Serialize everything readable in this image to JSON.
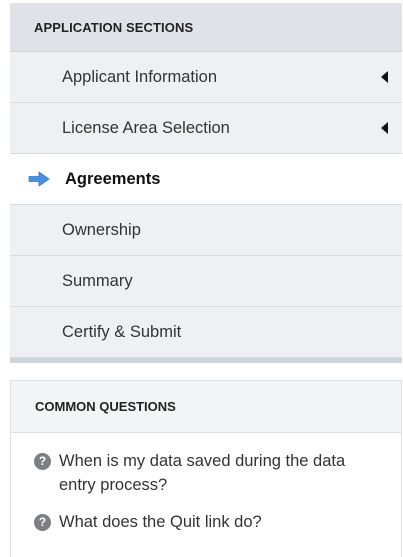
{
  "sections": {
    "header": "APPLICATION SECTIONS",
    "items": [
      {
        "label": "Applicant Information"
      },
      {
        "label": "License Area Selection"
      },
      {
        "label": "Agreements"
      },
      {
        "label": "Ownership"
      },
      {
        "label": "Summary"
      },
      {
        "label": "Certify & Submit"
      }
    ],
    "active_index": 2,
    "arrow_color": "#4a90e2"
  },
  "questions": {
    "header": "COMMON QUESTIONS",
    "items": [
      {
        "text": "When is my data saved during the data entry process?",
        "icon": "help-icon"
      },
      {
        "text": "What does the Quit link do?",
        "icon": "help-icon"
      }
    ]
  }
}
